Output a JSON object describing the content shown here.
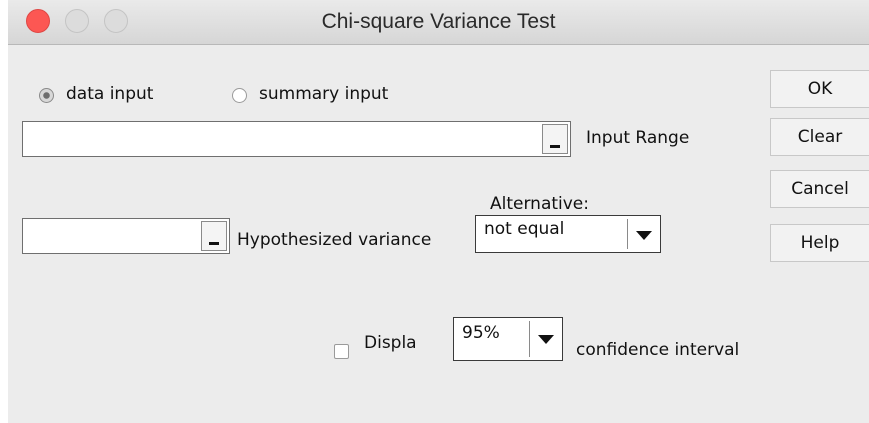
{
  "window": {
    "title": "Chi-square Variance Test"
  },
  "input_mode": {
    "data_input_label": "data input",
    "summary_input_label": "summary input",
    "selected": "data input"
  },
  "input_range": {
    "value": "",
    "label": "Input Range"
  },
  "hypothesized_variance": {
    "value": "",
    "label": "Hypothesized variance"
  },
  "alternative": {
    "label": "Alternative:",
    "selected": "not equal"
  },
  "confidence": {
    "checkbox_label": "Displa",
    "checked": false,
    "level": "95%",
    "suffix_label": "confidence interval"
  },
  "buttons": {
    "ok": "OK",
    "clear": "Clear",
    "cancel": "Cancel",
    "help": "Help"
  },
  "colors": {
    "close_button": "#fc5753",
    "window_background": "#ececec"
  }
}
